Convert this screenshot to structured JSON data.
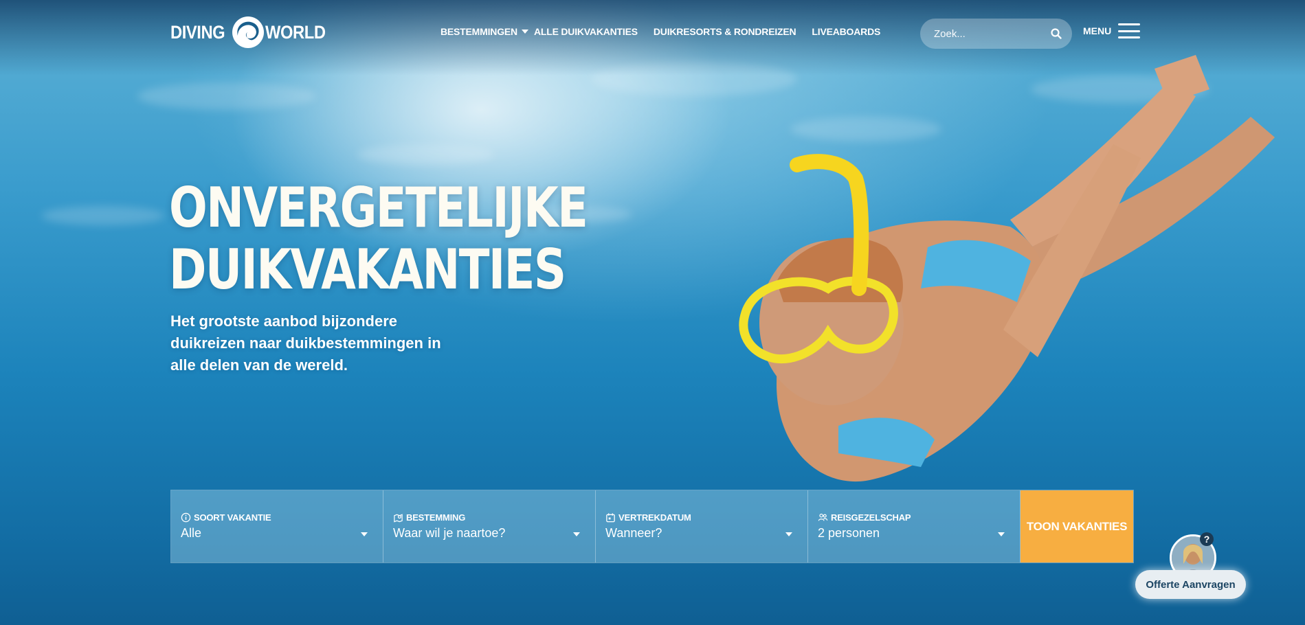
{
  "header": {
    "logo": {
      "left_word": "DIVING",
      "right_word": "WORLD"
    },
    "nav": [
      {
        "label": "BESTEMMINGEN",
        "has_dropdown": true
      },
      {
        "label": "ALLE DUIKVAKANTIES"
      },
      {
        "label": "DUIKRESORTS & RONDREIZEN"
      },
      {
        "label": "LIVEABOARDS"
      }
    ],
    "search": {
      "placeholder": "Zoek...",
      "value": ""
    },
    "menu_label": "MENU"
  },
  "hero": {
    "title_line1": "ONVERGETELIJKE",
    "title_line2": "DUIKVAKANTIES",
    "subtitle": "Het grootste aanbod bijzondere duikreizen naar duikbestemmingen in alle delen van de wereld."
  },
  "finder": {
    "fields": [
      {
        "label": "SOORT VAKANTIE",
        "value": "Alle",
        "icon": "info-icon"
      },
      {
        "label": "BESTEMMING",
        "value": "Waar wil je naartoe?",
        "icon": "map-pin-icon"
      },
      {
        "label": "VERTREKDATUM",
        "value": "Wanneer?",
        "icon": "calendar-icon"
      },
      {
        "label": "REISGEZELSCHAP",
        "value": "2 personen",
        "icon": "people-icon"
      }
    ],
    "submit_label": "TOON VAKANTIES"
  },
  "widget": {
    "badge": "?",
    "button_label": "Offerte Aanvragen"
  },
  "colors": {
    "accent": "#f7ae41",
    "ocean": "#1f7fb4",
    "title": "#fdfbf2"
  }
}
